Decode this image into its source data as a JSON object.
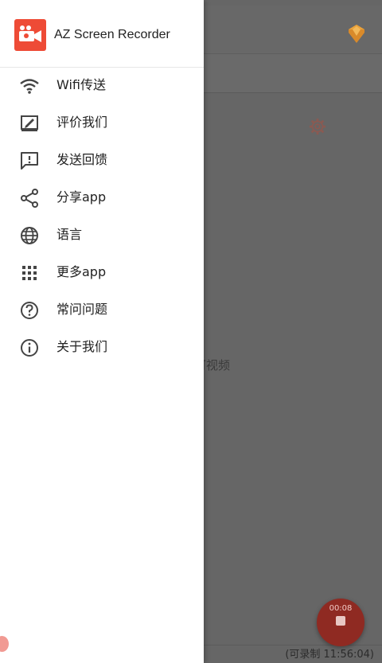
{
  "app": {
    "name": "AZ Screen Recorder"
  },
  "drawer": {
    "items": [
      {
        "label": "Wifi传送",
        "icon": "wifi-icon"
      },
      {
        "label": "评价我们",
        "icon": "rate-icon"
      },
      {
        "label": "发送回馈",
        "icon": "feedback-icon"
      },
      {
        "label": "分享app",
        "icon": "share-icon"
      },
      {
        "label": "语言",
        "icon": "globe-icon"
      },
      {
        "label": "更多app",
        "icon": "grid-icon"
      },
      {
        "label": "常问问题",
        "icon": "help-icon"
      },
      {
        "label": "关于我们",
        "icon": "info-icon"
      }
    ]
  },
  "background": {
    "hint_text": "可视频",
    "record_status": "(可录制 11:56:04)",
    "fab_time": "00:08"
  },
  "colors": {
    "accent": "#ee4b36",
    "overlay": "#666666",
    "premium": "#f0a030"
  }
}
